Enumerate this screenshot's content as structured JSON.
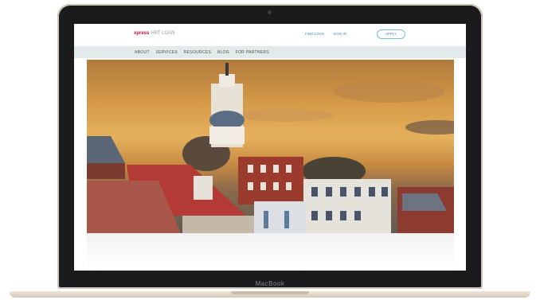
{
  "laptop": {
    "bezel_label": "MacBook"
  },
  "site": {
    "logo": "xpress",
    "logo_suffix": "HRT LOAN",
    "top_links": [
      "FIND LOAN",
      "SIGN IN"
    ],
    "cta": "APPLY",
    "nav": [
      "ABOUT",
      "SERVICES",
      "RESOURCES",
      "BLOG",
      "FOR PARTNERS"
    ]
  },
  "colors": {
    "brand_red": "#c8102e",
    "link_blue": "#3d8fb5",
    "nav_bg": "#e3ebea"
  }
}
